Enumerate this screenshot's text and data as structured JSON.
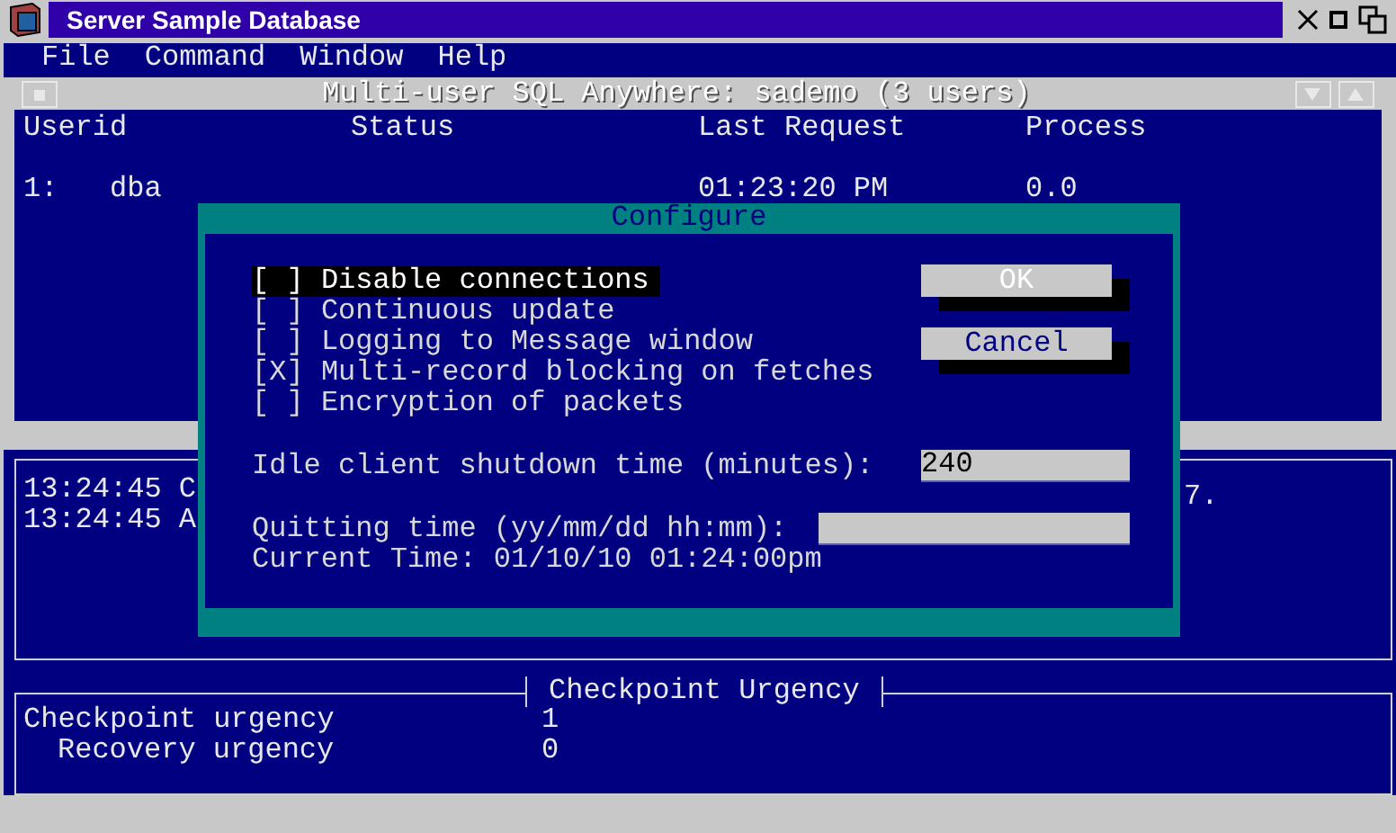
{
  "window": {
    "title": "Server Sample Database"
  },
  "menu": [
    "File",
    "Command",
    "Window",
    "Help"
  ],
  "connections_window": {
    "title": "Multi-user SQL Anywhere: sademo (3 users)",
    "columns": [
      "Userid",
      "Status",
      "Last Request",
      "Process"
    ],
    "rows": [
      {
        "number": "1:",
        "userid": "dba",
        "last_request": "01:23:20 PM",
        "process": "0.0"
      }
    ]
  },
  "log": {
    "lines": [
      "13:24:45 C",
      "13:24:45 A"
    ],
    "line_end": "7."
  },
  "checkpoint": {
    "title": "Checkpoint Urgency",
    "rows": [
      {
        "label": "Checkpoint urgency",
        "value": "1",
        "children": [
          {
            "label": "Recovery urgency",
            "value": "0"
          }
        ]
      }
    ]
  },
  "dialog": {
    "title": "Configure",
    "checkbox_glyphs": {
      "open": "[",
      "close": "]",
      "mark": "X"
    },
    "options": [
      {
        "label": "Disable connections",
        "checked": false,
        "focused": true
      },
      {
        "label": "Continuous update",
        "checked": false,
        "focused": false
      },
      {
        "label": "Logging to Message window",
        "checked": false,
        "focused": false
      },
      {
        "label": "Multi-record blocking on fetches",
        "checked": true,
        "focused": false
      },
      {
        "label": "Encryption of packets",
        "checked": false,
        "focused": false
      }
    ],
    "buttons": [
      {
        "label": "OK",
        "default": true
      },
      {
        "label": "Cancel",
        "default": false
      }
    ],
    "fields": [
      {
        "kind": "short",
        "label": "Idle client shutdown time (minutes):",
        "value": "240"
      },
      {
        "kind": "long",
        "label": "Quitting time (yy/mm/dd hh:mm):"
      }
    ],
    "current_time": "Current Time: 01/10/10 01:24:00pm"
  }
}
